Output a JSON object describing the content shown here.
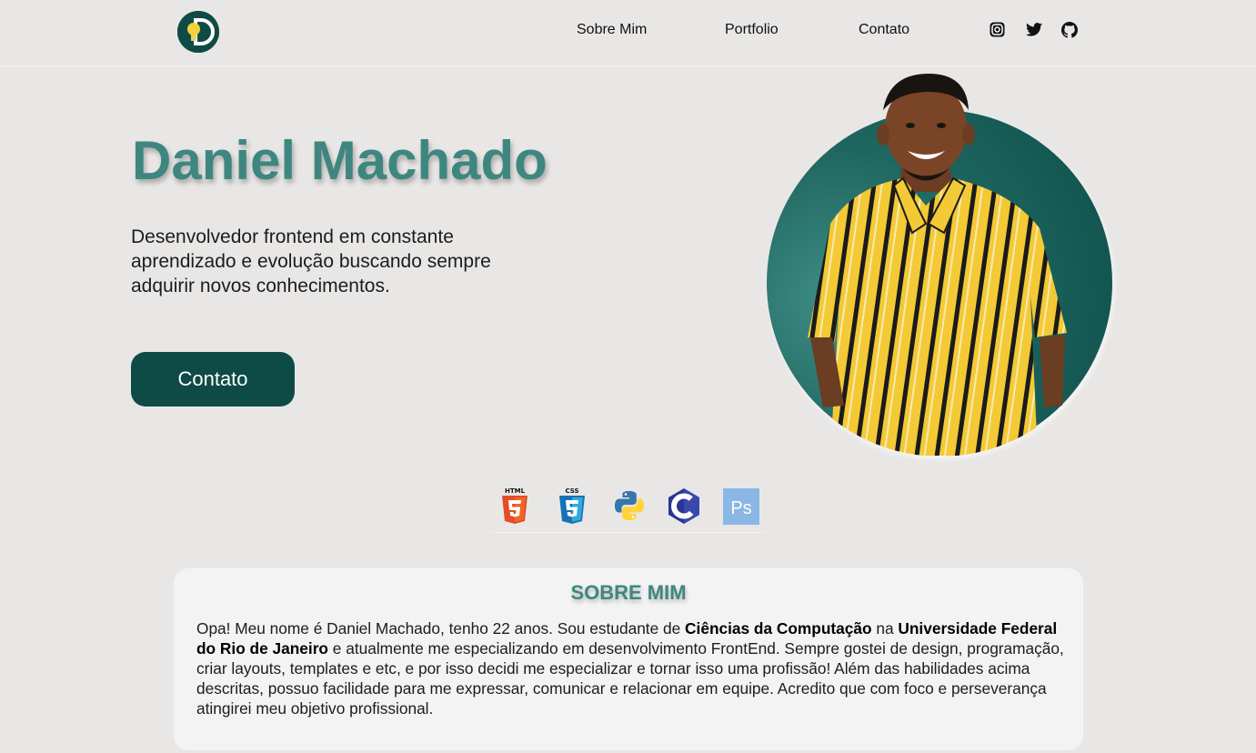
{
  "header": {
    "nav": [
      {
        "label": "Sobre Mim"
      },
      {
        "label": "Portfolio"
      },
      {
        "label": "Contato"
      }
    ],
    "social": [
      "instagram-icon",
      "twitter-icon",
      "github-icon"
    ]
  },
  "hero": {
    "name": "Daniel Machado",
    "description": "Desenvolvedor frontend em constante aprendizado e evolução buscando sempre adquirir novos conhecimentos.",
    "button_label": "Contato"
  },
  "skills": [
    "html5-icon",
    "css3-icon",
    "python-icon",
    "c-icon",
    "photoshop-icon"
  ],
  "about": {
    "title": "SOBRE MIM",
    "text_1": "Opa! Meu nome é Daniel Machado, tenho 22 anos. Sou estudante de ",
    "bold_1": "Ciências da Computação",
    "text_2": " na ",
    "bold_2": "Universidade Federal do Rio de Janeiro",
    "text_3": " e atualmente me especializando em desenvolvimento FrontEnd. Sempre gostei de design, programação, criar layouts, templates e etc, e por isso decidi me especializar e tornar isso uma profissão! Além das habilidades acima descritas, possuo facilidade para me expressar, comunicar e relacionar em equipe. Acredito que com foco e perseverança atingirei meu objetivo profissional."
  },
  "colors": {
    "accent": "#3e8781",
    "dark": "#0e4b47",
    "background": "#e9e7e6"
  }
}
